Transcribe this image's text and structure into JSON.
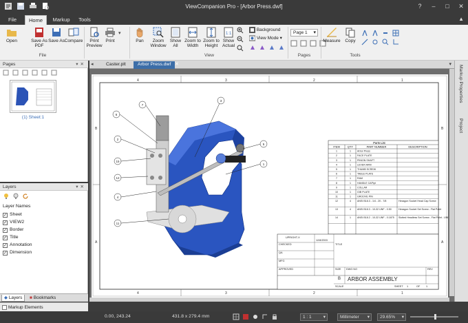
{
  "window": {
    "title": "ViewCompanion Pro - [Arbor Press.dwf]"
  },
  "menu": {
    "tabs": [
      "File",
      "Home",
      "Markup",
      "Tools"
    ],
    "active": "Home"
  },
  "ribbon": {
    "file_group": {
      "label": "File",
      "buttons": [
        "Open",
        "Save As PDF",
        "Save As",
        "Compare"
      ]
    },
    "print_group": {
      "buttons": [
        "Print Preview",
        "Print"
      ]
    },
    "view_group": {
      "label": "View",
      "buttons": [
        "Pan",
        "Zoom Window",
        "Show All",
        "Zoom to Width",
        "Zoom to Height",
        "Show Actual"
      ],
      "background_label": "Background",
      "view_mode_label": "View Mode"
    },
    "pages_group": {
      "label": "Pages",
      "page_select": "Page 1"
    },
    "tools_group": {
      "label": "Tools",
      "buttons": [
        "Measure",
        "Copy"
      ]
    }
  },
  "pages_panel": {
    "title": "Pages",
    "thumbnail_caption": "(1) Sheet:1"
  },
  "layers_panel": {
    "title": "Layers",
    "header": "Layer Names",
    "layers": [
      {
        "name": "Sheet",
        "checked": true
      },
      {
        "name": "VIEW2",
        "checked": true
      },
      {
        "name": "Border",
        "checked": true
      },
      {
        "name": "Title",
        "checked": true
      },
      {
        "name": "Annotation",
        "checked": true
      },
      {
        "name": "Dimension",
        "checked": true
      }
    ]
  },
  "bottom_tabs": [
    "Layers",
    "Bookmarks"
  ],
  "markup_elements_label": "Markup Elements",
  "doc_tabs": [
    {
      "label": "Caster.plt",
      "active": false
    },
    {
      "label": "Arbor Press.dwf",
      "active": true
    }
  ],
  "right_panel": [
    "Markup Properties",
    "Project"
  ],
  "drawing": {
    "col_numbers_top": [
      "4",
      "3",
      "2",
      "1"
    ],
    "row_letters": [
      "B",
      "A"
    ],
    "callouts": [
      "7",
      "3",
      "5",
      "1",
      "6",
      "2",
      "15",
      "12",
      "4",
      "11"
    ],
    "parts_list": {
      "title": "Parts List",
      "headers": [
        "ITEM",
        "QTY",
        "PART NUMBER",
        "DESCRIPTION"
      ],
      "rows": [
        [
          "1",
          "1",
          "Arbor Press",
          ""
        ],
        [
          "2",
          "1",
          "FACE PLATE",
          ""
        ],
        [
          "3",
          "1",
          "PINION SHAFT",
          ""
        ],
        [
          "4",
          "1",
          "LEVER ARM",
          ""
        ],
        [
          "5",
          "1",
          "THUMB SCREW",
          ""
        ],
        [
          "6",
          "1",
          "TABLE PLATE",
          ""
        ],
        [
          "7",
          "1",
          "RAM",
          ""
        ],
        [
          "8",
          "1",
          "HANDLE CAPipt",
          ""
        ],
        [
          "9",
          "1",
          "COLLAR",
          ""
        ],
        [
          "10",
          "1",
          "GIB PLATE",
          ""
        ],
        [
          "11",
          "1",
          "GROOVE PIN",
          ""
        ],
        [
          "12",
          "4",
          "ANSI B18.3 - 1/4 - 20 - 7/8",
          "Hexagon Socket Head Cap Screw"
        ],
        [
          "13",
          "4",
          "ANSI B18.3 - 10-32 UNF - 0.50",
          "Hexagon Socket Set Screw - Flat Point"
        ],
        [
          "14",
          "1",
          "ANSI B18.2 - 10-32 UNF - 0.1875",
          "Slotted Headless Set Screw - Flat Point - UNF (Fine Thread - Inch)"
        ]
      ]
    },
    "title_block": {
      "checked": "CHECKED",
      "qa": "QA",
      "mfg": "MFG",
      "approved": "APPROVED",
      "drawn_label": "UPRIGHT-X",
      "date": "12/8/2003",
      "title_label": "TITLE",
      "size_label": "SIZE",
      "size": "B",
      "dwg_no_label": "DWG NO",
      "dwg_no": "ARBOR ASSEMBLY",
      "rev_label": "REV",
      "scale_label": "SCALE",
      "sheet_label": "SHEET",
      "sheet": "1",
      "of_label": "OF",
      "of": "1"
    }
  },
  "status": {
    "coords": "0.00, 243.24",
    "page_size": "431.8 x 279.4 mm",
    "scale": "1 : 1",
    "units": "Millimeter",
    "zoom": "29.65%"
  }
}
